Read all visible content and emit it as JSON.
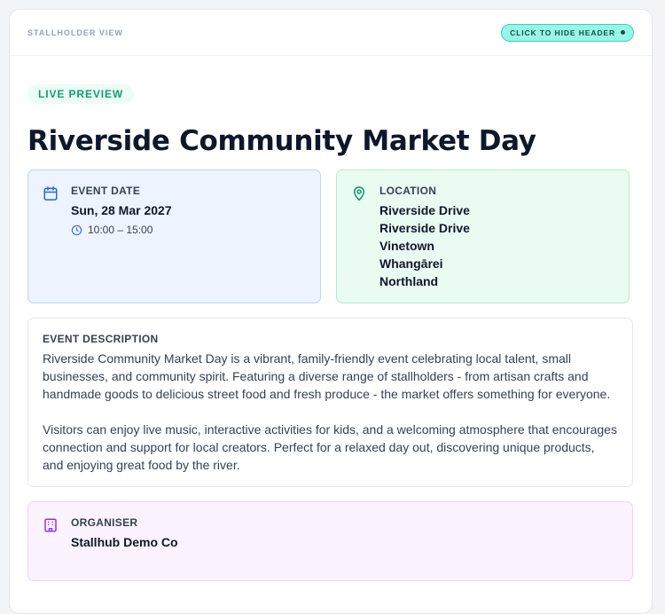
{
  "header": {
    "view_label": "STALLHOLDER VIEW",
    "hide_button": "CLICK TO HIDE HEADER"
  },
  "badge": "LIVE PREVIEW",
  "event": {
    "title": "Riverside Community Market Day",
    "date_label": "EVENT DATE",
    "date": "Sun, 28 Mar 2027",
    "time": "10:00 – 15:00",
    "location_label": "LOCATION",
    "location_lines": [
      "Riverside Drive",
      "Riverside Drive",
      "Vinetown",
      "Whangārei",
      "Northland"
    ],
    "description_label": "EVENT DESCRIPTION",
    "description_paragraphs": [
      "Riverside Community Market Day is a vibrant, family-friendly event celebrating local talent, small businesses, and community spirit. Featuring a diverse range of stallholders - from artisan crafts and handmade goods to delicious street food and fresh produce - the market offers something for everyone.",
      "Visitors can enjoy live music, interactive activities for kids, and a welcoming atmosphere that encourages connection and support for local creators. Perfect for a relaxed day out, discovering unique products, and enjoying great food by the river."
    ],
    "organiser_label": "ORGANISER",
    "organiser": "Stallhub Demo Co"
  },
  "colors": {
    "date_icon": "#2563eb",
    "location_icon": "#059669",
    "organiser_icon": "#9333ea"
  }
}
